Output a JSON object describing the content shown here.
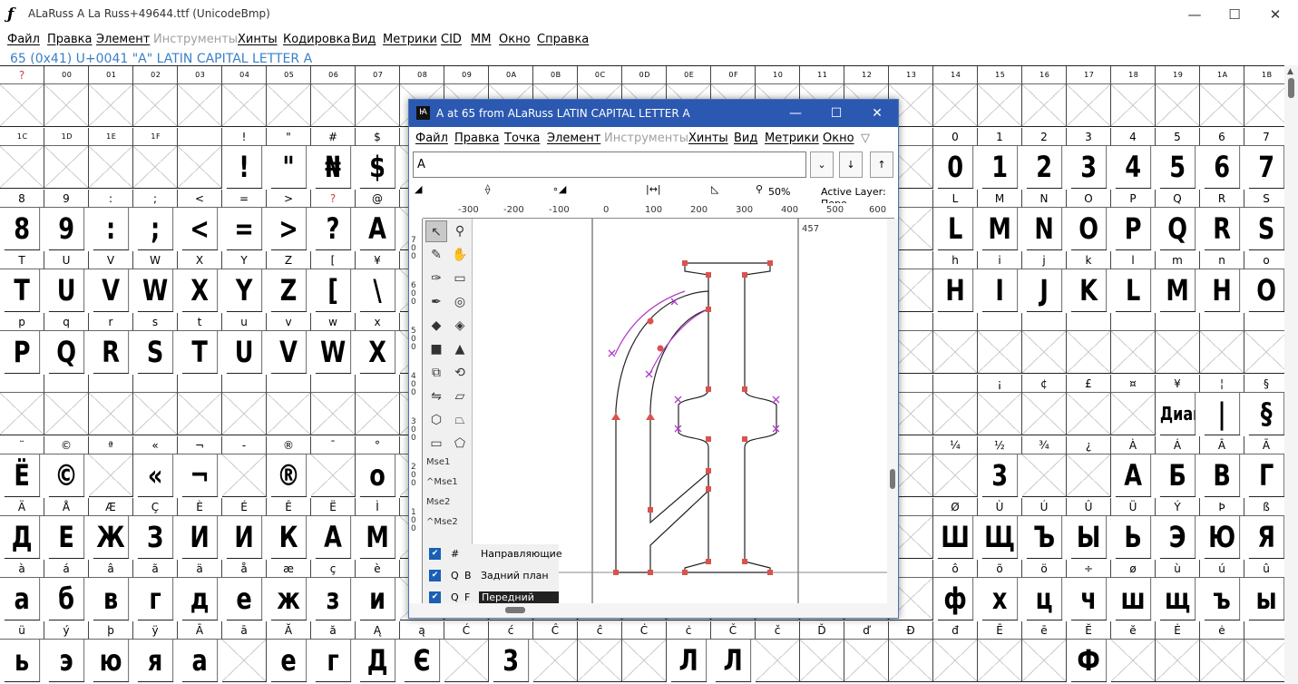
{
  "window": {
    "title": "ALaRuss  A La Russ+49644.ttf (UnicodeBmp)",
    "minimize": "—",
    "maximize": "☐",
    "close": "✕"
  },
  "menu": [
    {
      "label": "Файл",
      "disabled": false
    },
    {
      "label": "Правка",
      "disabled": false
    },
    {
      "label": "Элемент",
      "disabled": false
    },
    {
      "label": "Инструменты",
      "disabled": true
    },
    {
      "label": "Хинты",
      "disabled": false
    },
    {
      "label": "Кодировка",
      "disabled": false
    },
    {
      "label": "Вид",
      "disabled": false
    },
    {
      "label": "Метрики",
      "disabled": false
    },
    {
      "label": "CID",
      "disabled": false
    },
    {
      "label": "MM",
      "disabled": false
    },
    {
      "label": "Окно",
      "disabled": false
    },
    {
      "label": "Справка",
      "disabled": false
    }
  ],
  "info_line": "65 (0x41) U+0041 \"A\" LATIN CAPITAL LETTER A",
  "grid": {
    "rows": [
      {
        "headers": [
          "?",
          "0 0",
          "0 1",
          "0 2",
          "0 3",
          "0 4",
          "0 5",
          "0 6",
          "0 7",
          "0 8",
          "0 9",
          "0 A",
          "0 B",
          "0 C",
          "0 D",
          "0 E",
          "0 F",
          "1 0",
          "1 1",
          "1 2",
          "1 3",
          "1 4",
          "1 5",
          "1 6",
          "1 7",
          "1 8",
          "1 9",
          "1 A",
          "1 B"
        ],
        "glyphs": [
          "",
          "",
          "",
          "",
          "",
          "",
          "",
          "",
          "",
          "",
          "",
          "",
          "",
          "",
          "",
          "",
          "",
          "",
          "",
          "",
          "",
          "",
          "",
          "",
          "",
          "",
          "",
          "",
          ""
        ]
      },
      {
        "headers": [
          "1 C",
          "1 D",
          "1 E",
          "1 F",
          "",
          "!",
          "\"",
          "#",
          "$",
          "",
          "",
          "",
          "",
          "",
          "",
          "",
          "",
          "",
          "",
          "",
          "",
          "0",
          "1",
          "2",
          "3",
          "4",
          "5",
          "6",
          "7"
        ],
        "glyphs": [
          "",
          "",
          "",
          "",
          "",
          "!",
          "\"",
          "₦",
          "$",
          "",
          "",
          "",
          "",
          "",
          "",
          "",
          "",
          "",
          "",
          "",
          "",
          "0",
          "1",
          "2",
          "3",
          "4",
          "5",
          "6",
          "7"
        ]
      },
      {
        "headers": [
          "8",
          "9",
          ":",
          ";",
          "<",
          "=",
          ">",
          "?",
          "@",
          "",
          "",
          "",
          "",
          "",
          "",
          "",
          "",
          "",
          "",
          "",
          "",
          "L",
          "M",
          "N",
          "O",
          "P",
          "Q",
          "R",
          "S"
        ],
        "glyphs": [
          "8",
          "9",
          ":",
          ";",
          "<",
          "=",
          ">",
          "?",
          "A",
          "",
          "",
          "",
          "",
          "",
          "",
          "",
          "",
          "",
          "",
          "",
          "",
          "L",
          "M",
          "N",
          "O",
          "P",
          "Q",
          "R",
          "S"
        ]
      },
      {
        "headers": [
          "T",
          "U",
          "V",
          "W",
          "X",
          "Y",
          "Z",
          "[",
          "¥",
          "",
          "",
          "",
          "",
          "",
          "",
          "",
          "",
          "",
          "",
          "",
          "",
          "h",
          "i",
          "j",
          "k",
          "l",
          "m",
          "n",
          "o"
        ],
        "glyphs": [
          "T",
          "U",
          "V",
          "W",
          "X",
          "Y",
          "Z",
          "[",
          "\\",
          "",
          "",
          "",
          "",
          "",
          "",
          "",
          "",
          "",
          "",
          "",
          "",
          "H",
          "I",
          "J",
          "K",
          "L",
          "M",
          "H",
          "O"
        ]
      },
      {
        "headers": [
          "p",
          "q",
          "r",
          "s",
          "t",
          "u",
          "v",
          "w",
          "x",
          "",
          "",
          "",
          "",
          "",
          "",
          "",
          "",
          "",
          "",
          "",
          "",
          "",
          "",
          "",
          "",
          "",
          "",
          "",
          ""
        ],
        "glyphs": [
          "P",
          "Q",
          "R",
          "S",
          "T",
          "U",
          "V",
          "W",
          "X",
          "",
          "",
          "",
          "",
          "",
          "",
          "",
          "",
          "",
          "",
          "",
          "",
          "",
          "",
          "",
          "",
          "",
          "",
          "",
          ""
        ]
      },
      {
        "headers": [
          "",
          "",
          "",
          "",
          "",
          "",
          "",
          "",
          "",
          "",
          "",
          "",
          "",
          "",
          "",
          "",
          "",
          "",
          "",
          "",
          "",
          "",
          "¡",
          "¢",
          "£",
          "¤",
          "¥",
          "¦",
          "§"
        ],
        "glyphs": [
          "",
          "",
          "",
          "",
          "",
          "",
          "",
          "",
          "",
          "",
          "",
          "",
          "",
          "",
          "",
          "",
          "",
          "",
          "",
          "",
          "",
          "",
          "",
          "",
          "",
          "",
          "Диай",
          "|",
          "§"
        ]
      },
      {
        "headers": [
          "¨",
          "©",
          "ª",
          "«",
          "¬",
          "-",
          "®",
          "¯",
          "°",
          "",
          "",
          "",
          "",
          "",
          "",
          "",
          "",
          "",
          "",
          "",
          "",
          "¼",
          "½",
          "¾",
          "¿",
          "À",
          "Á",
          "Â",
          "Ã"
        ],
        "glyphs": [
          "Ё",
          "©",
          "",
          "«",
          "¬",
          "",
          "®",
          "",
          "o",
          "",
          "",
          "",
          "",
          "",
          "",
          "",
          "",
          "",
          "",
          "",
          "",
          "",
          "3",
          "",
          "",
          "A",
          "Б",
          "В",
          "Г"
        ]
      },
      {
        "headers": [
          "Ä",
          "Å",
          "Æ",
          "Ç",
          "È",
          "É",
          "Ê",
          "Ë",
          "Ì",
          "",
          "",
          "",
          "",
          "",
          "",
          "",
          "",
          "",
          "",
          "",
          "",
          "Ø",
          "Ù",
          "Ú",
          "Û",
          "Ü",
          "Ý",
          "Þ",
          "ß"
        ],
        "glyphs": [
          "Д",
          "Е",
          "Ж",
          "З",
          "И",
          "И",
          "К",
          "A",
          "М",
          "",
          "",
          "",
          "",
          "",
          "",
          "",
          "",
          "",
          "",
          "",
          "",
          "Ш",
          "Щ",
          "Ъ",
          "Ы",
          "Ь",
          "Э",
          "Ю",
          "Я"
        ]
      },
      {
        "headers": [
          "à",
          "á",
          "â",
          "ã",
          "ä",
          "å",
          "æ",
          "ç",
          "è",
          "",
          "",
          "",
          "",
          "",
          "",
          "",
          "",
          "",
          "",
          "",
          "",
          "ô",
          "õ",
          "ö",
          "÷",
          "ø",
          "ù",
          "ú",
          "û"
        ],
        "glyphs": [
          "а",
          "б",
          "в",
          "г",
          "д",
          "е",
          "ж",
          "з",
          "и",
          "",
          "",
          "",
          "",
          "",
          "",
          "",
          "",
          "",
          "",
          "",
          "",
          "ф",
          "х",
          "ц",
          "ч",
          "ш",
          "щ",
          "ъ",
          "ы"
        ]
      },
      {
        "headers": [
          "ü",
          "ý",
          "þ",
          "ÿ",
          "Ā",
          "ā",
          "Ă",
          "ă",
          "Ą",
          "ą",
          "Ć",
          "ć",
          "Ĉ",
          "ĉ",
          "Ċ",
          "ċ",
          "Č",
          "č",
          "Ď",
          "ď",
          "Đ",
          "đ",
          "Ē",
          "ē",
          "Ĕ",
          "ĕ",
          "Ė",
          "ė",
          ""
        ],
        "glyphs": [
          "ь",
          "э",
          "ю",
          "я",
          "а",
          "",
          "е",
          "г",
          "Д",
          "Є",
          "",
          "3",
          "",
          "",
          "",
          "Л",
          "Л",
          "",
          "",
          "",
          "",
          "",
          "",
          "",
          "Ф",
          "",
          "",
          "",
          ""
        ]
      }
    ]
  },
  "glyph_window": {
    "title": "A at 65 from ALaRuss LATIN CAPITAL LETTER A",
    "menu": [
      {
        "label": "Файл",
        "disabled": false
      },
      {
        "label": "Правка",
        "disabled": false
      },
      {
        "label": "Точка",
        "disabled": false
      },
      {
        "label": "Элемент",
        "disabled": false
      },
      {
        "label": "Инструменты",
        "disabled": true
      },
      {
        "label": "Хинты",
        "disabled": false
      },
      {
        "label": "Вид",
        "disabled": false
      },
      {
        "label": "Метрики",
        "disabled": false
      },
      {
        "label": "Окно",
        "disabled": false
      }
    ],
    "input_value": "A",
    "zoom": "50%",
    "active_layer": "Active Layer: Пере",
    "ruler_ticks": [
      "-300",
      "-200",
      "-100",
      "0",
      "100",
      "200",
      "300",
      "400",
      "500",
      "600"
    ],
    "vruler_ticks": [
      "7 0 0",
      "6 0 0",
      "5 0 0",
      "4 0 0",
      "3 0 0",
      "2 0 0",
      "1 0 0"
    ],
    "advance_label": "457",
    "mouse_labels": [
      "Mse1",
      "^Mse1",
      "Mse2",
      "^Mse2"
    ],
    "layers": [
      {
        "key1": "#",
        "key2": "",
        "name": "Направляющие",
        "checked": true
      },
      {
        "key1": "Q",
        "key2": "B",
        "name": "Задний план",
        "checked": true
      },
      {
        "key1": "Q",
        "key2": "F",
        "name": "Передний план",
        "checked": true
      }
    ]
  },
  "colors": {
    "accent": "#2b58b0",
    "info_text": "#3a80c8",
    "outline": "#222222",
    "control_point": "#d9534f",
    "handle": "#b03cc8"
  }
}
